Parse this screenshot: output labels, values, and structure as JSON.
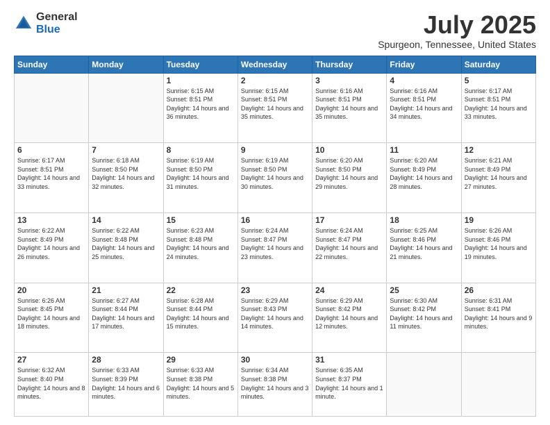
{
  "logo": {
    "general": "General",
    "blue": "Blue"
  },
  "header": {
    "month": "July 2025",
    "location": "Spurgeon, Tennessee, United States"
  },
  "weekdays": [
    "Sunday",
    "Monday",
    "Tuesday",
    "Wednesday",
    "Thursday",
    "Friday",
    "Saturday"
  ],
  "weeks": [
    [
      {
        "day": "",
        "sunrise": "",
        "sunset": "",
        "daylight": ""
      },
      {
        "day": "",
        "sunrise": "",
        "sunset": "",
        "daylight": ""
      },
      {
        "day": "1",
        "sunrise": "Sunrise: 6:15 AM",
        "sunset": "Sunset: 8:51 PM",
        "daylight": "Daylight: 14 hours and 36 minutes."
      },
      {
        "day": "2",
        "sunrise": "Sunrise: 6:15 AM",
        "sunset": "Sunset: 8:51 PM",
        "daylight": "Daylight: 14 hours and 35 minutes."
      },
      {
        "day": "3",
        "sunrise": "Sunrise: 6:16 AM",
        "sunset": "Sunset: 8:51 PM",
        "daylight": "Daylight: 14 hours and 35 minutes."
      },
      {
        "day": "4",
        "sunrise": "Sunrise: 6:16 AM",
        "sunset": "Sunset: 8:51 PM",
        "daylight": "Daylight: 14 hours and 34 minutes."
      },
      {
        "day": "5",
        "sunrise": "Sunrise: 6:17 AM",
        "sunset": "Sunset: 8:51 PM",
        "daylight": "Daylight: 14 hours and 33 minutes."
      }
    ],
    [
      {
        "day": "6",
        "sunrise": "Sunrise: 6:17 AM",
        "sunset": "Sunset: 8:51 PM",
        "daylight": "Daylight: 14 hours and 33 minutes."
      },
      {
        "day": "7",
        "sunrise": "Sunrise: 6:18 AM",
        "sunset": "Sunset: 8:50 PM",
        "daylight": "Daylight: 14 hours and 32 minutes."
      },
      {
        "day": "8",
        "sunrise": "Sunrise: 6:19 AM",
        "sunset": "Sunset: 8:50 PM",
        "daylight": "Daylight: 14 hours and 31 minutes."
      },
      {
        "day": "9",
        "sunrise": "Sunrise: 6:19 AM",
        "sunset": "Sunset: 8:50 PM",
        "daylight": "Daylight: 14 hours and 30 minutes."
      },
      {
        "day": "10",
        "sunrise": "Sunrise: 6:20 AM",
        "sunset": "Sunset: 8:50 PM",
        "daylight": "Daylight: 14 hours and 29 minutes."
      },
      {
        "day": "11",
        "sunrise": "Sunrise: 6:20 AM",
        "sunset": "Sunset: 8:49 PM",
        "daylight": "Daylight: 14 hours and 28 minutes."
      },
      {
        "day": "12",
        "sunrise": "Sunrise: 6:21 AM",
        "sunset": "Sunset: 8:49 PM",
        "daylight": "Daylight: 14 hours and 27 minutes."
      }
    ],
    [
      {
        "day": "13",
        "sunrise": "Sunrise: 6:22 AM",
        "sunset": "Sunset: 8:49 PM",
        "daylight": "Daylight: 14 hours and 26 minutes."
      },
      {
        "day": "14",
        "sunrise": "Sunrise: 6:22 AM",
        "sunset": "Sunset: 8:48 PM",
        "daylight": "Daylight: 14 hours and 25 minutes."
      },
      {
        "day": "15",
        "sunrise": "Sunrise: 6:23 AM",
        "sunset": "Sunset: 8:48 PM",
        "daylight": "Daylight: 14 hours and 24 minutes."
      },
      {
        "day": "16",
        "sunrise": "Sunrise: 6:24 AM",
        "sunset": "Sunset: 8:47 PM",
        "daylight": "Daylight: 14 hours and 23 minutes."
      },
      {
        "day": "17",
        "sunrise": "Sunrise: 6:24 AM",
        "sunset": "Sunset: 8:47 PM",
        "daylight": "Daylight: 14 hours and 22 minutes."
      },
      {
        "day": "18",
        "sunrise": "Sunrise: 6:25 AM",
        "sunset": "Sunset: 8:46 PM",
        "daylight": "Daylight: 14 hours and 21 minutes."
      },
      {
        "day": "19",
        "sunrise": "Sunrise: 6:26 AM",
        "sunset": "Sunset: 8:46 PM",
        "daylight": "Daylight: 14 hours and 19 minutes."
      }
    ],
    [
      {
        "day": "20",
        "sunrise": "Sunrise: 6:26 AM",
        "sunset": "Sunset: 8:45 PM",
        "daylight": "Daylight: 14 hours and 18 minutes."
      },
      {
        "day": "21",
        "sunrise": "Sunrise: 6:27 AM",
        "sunset": "Sunset: 8:44 PM",
        "daylight": "Daylight: 14 hours and 17 minutes."
      },
      {
        "day": "22",
        "sunrise": "Sunrise: 6:28 AM",
        "sunset": "Sunset: 8:44 PM",
        "daylight": "Daylight: 14 hours and 15 minutes."
      },
      {
        "day": "23",
        "sunrise": "Sunrise: 6:29 AM",
        "sunset": "Sunset: 8:43 PM",
        "daylight": "Daylight: 14 hours and 14 minutes."
      },
      {
        "day": "24",
        "sunrise": "Sunrise: 6:29 AM",
        "sunset": "Sunset: 8:42 PM",
        "daylight": "Daylight: 14 hours and 12 minutes."
      },
      {
        "day": "25",
        "sunrise": "Sunrise: 6:30 AM",
        "sunset": "Sunset: 8:42 PM",
        "daylight": "Daylight: 14 hours and 11 minutes."
      },
      {
        "day": "26",
        "sunrise": "Sunrise: 6:31 AM",
        "sunset": "Sunset: 8:41 PM",
        "daylight": "Daylight: 14 hours and 9 minutes."
      }
    ],
    [
      {
        "day": "27",
        "sunrise": "Sunrise: 6:32 AM",
        "sunset": "Sunset: 8:40 PM",
        "daylight": "Daylight: 14 hours and 8 minutes."
      },
      {
        "day": "28",
        "sunrise": "Sunrise: 6:33 AM",
        "sunset": "Sunset: 8:39 PM",
        "daylight": "Daylight: 14 hours and 6 minutes."
      },
      {
        "day": "29",
        "sunrise": "Sunrise: 6:33 AM",
        "sunset": "Sunset: 8:38 PM",
        "daylight": "Daylight: 14 hours and 5 minutes."
      },
      {
        "day": "30",
        "sunrise": "Sunrise: 6:34 AM",
        "sunset": "Sunset: 8:38 PM",
        "daylight": "Daylight: 14 hours and 3 minutes."
      },
      {
        "day": "31",
        "sunrise": "Sunrise: 6:35 AM",
        "sunset": "Sunset: 8:37 PM",
        "daylight": "Daylight: 14 hours and 1 minute."
      },
      {
        "day": "",
        "sunrise": "",
        "sunset": "",
        "daylight": ""
      },
      {
        "day": "",
        "sunrise": "",
        "sunset": "",
        "daylight": ""
      }
    ]
  ]
}
